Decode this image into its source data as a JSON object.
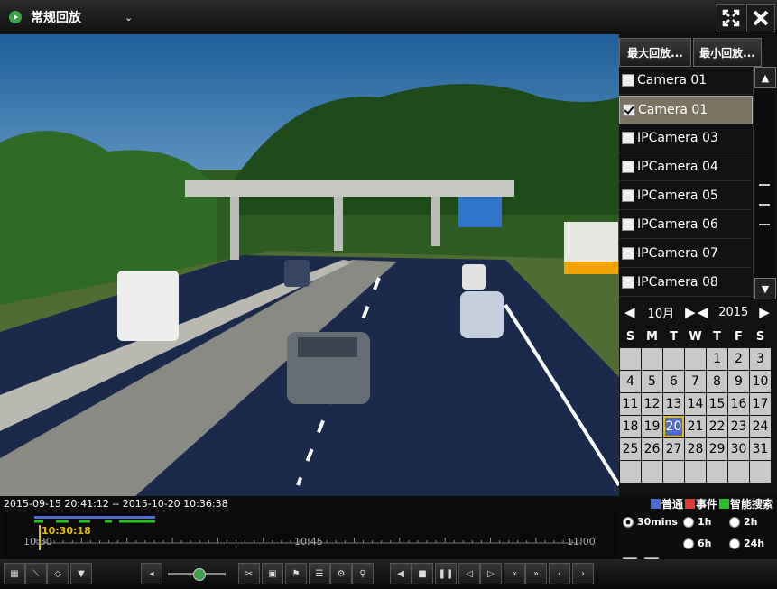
{
  "title": {
    "label": "常规回放"
  },
  "side": {
    "max_label": "最大回放...",
    "min_label": "最小回放...",
    "cameras": [
      {
        "label": "Camera 01",
        "checked": false
      },
      {
        "label": "Camera 01",
        "checked": true
      },
      {
        "label": "IPCamera 03",
        "checked": false
      },
      {
        "label": "IPCamera 04",
        "checked": false
      },
      {
        "label": "IPCamera 05",
        "checked": false
      },
      {
        "label": "IPCamera 06",
        "checked": false
      },
      {
        "label": "IPCamera 07",
        "checked": false
      },
      {
        "label": "IPCamera 08",
        "checked": false
      }
    ]
  },
  "calendar": {
    "month": "10月",
    "year": "2015",
    "weekdays": [
      "S",
      "M",
      "T",
      "W",
      "T",
      "F",
      "S"
    ],
    "days": [
      "",
      "",
      "",
      "",
      "1",
      "2",
      "3",
      "4",
      "5",
      "6",
      "7",
      "8",
      "9",
      "10",
      "11",
      "12",
      "13",
      "14",
      "15",
      "16",
      "17",
      "18",
      "19",
      "20",
      "21",
      "22",
      "23",
      "24",
      "25",
      "26",
      "27",
      "28",
      "29",
      "30",
      "31",
      "",
      "",
      "",
      "",
      "",
      "",
      ""
    ],
    "selected": "20"
  },
  "bottom": {
    "range": "2015-09-15 20:41:12 -- 2015-10-20 10:36:38",
    "cursor_time": "10:30:18",
    "ticks": [
      "10:30",
      "10:45",
      "11:00"
    ],
    "legend": [
      {
        "label": "普通",
        "color": "#4d6bd0"
      },
      {
        "label": "事件",
        "color": "#e53935"
      },
      {
        "label": "智能搜索",
        "color": "#22c422"
      }
    ],
    "zoom": [
      {
        "label": "30mins",
        "selected": true
      },
      {
        "label": "1h",
        "selected": false
      },
      {
        "label": "2h",
        "selected": false
      },
      {
        "label": "6h",
        "selected": false
      },
      {
        "label": "24h",
        "selected": false
      }
    ]
  }
}
